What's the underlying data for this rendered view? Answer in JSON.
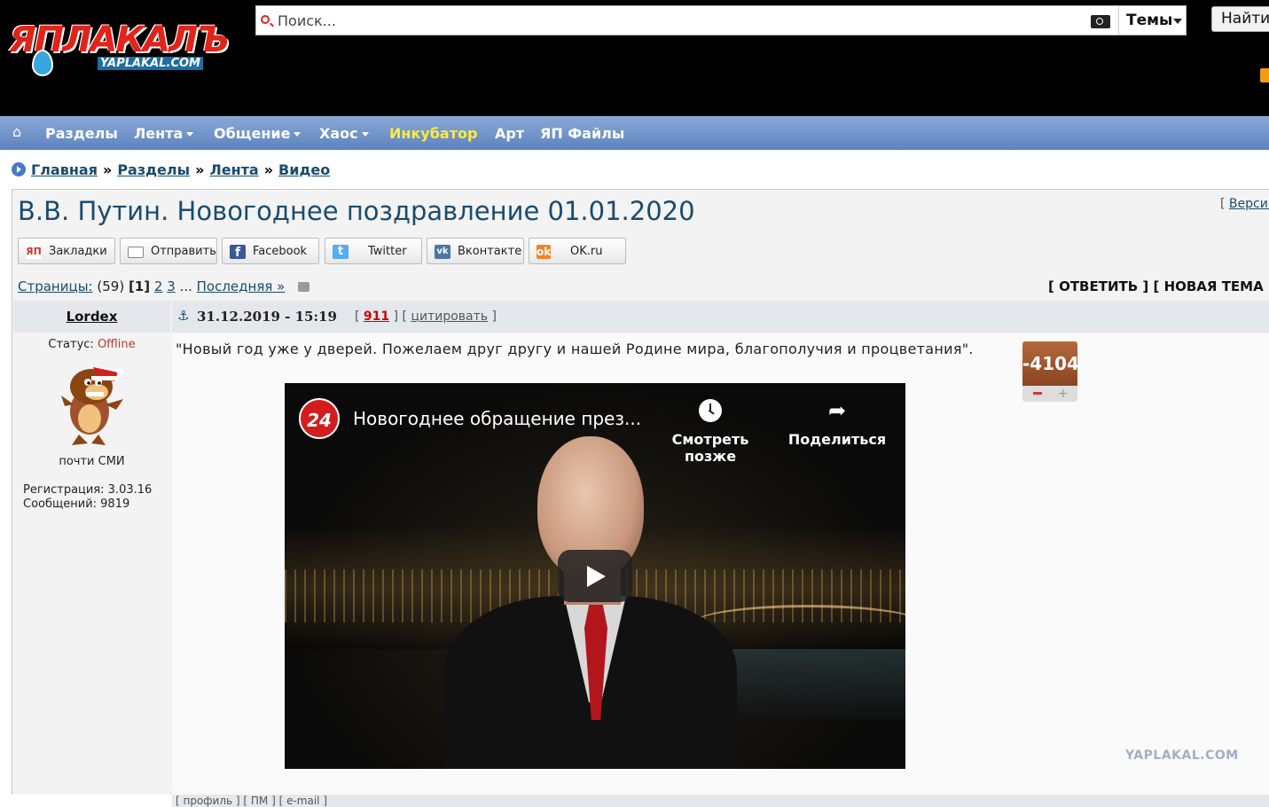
{
  "header": {
    "logo_text": "ЯПЛАКАЛЪ",
    "logo_sub": "YAPLAKAL.COM",
    "search_placeholder": "Поиск...",
    "topics_label": "Темы",
    "find_label": "Найти"
  },
  "nav": {
    "items": [
      {
        "label": "Разделы"
      },
      {
        "label": "Лента"
      },
      {
        "label": "Общение"
      },
      {
        "label": "Хаос"
      },
      {
        "label": "Инкубатор"
      },
      {
        "label": "Арт"
      },
      {
        "label": "ЯП Файлы"
      }
    ]
  },
  "breadcrumb": {
    "items": [
      "Главная",
      "Разделы",
      "Лента",
      "Видео"
    ],
    "sep": "»"
  },
  "topic": {
    "title": "В.В. Путин. Новогоднее поздравление 01.01.2020",
    "version_bracket": "[",
    "version_link": "Версия"
  },
  "share": [
    {
      "label": "Закладки",
      "icon": "yap-icon",
      "color": "#c0392b"
    },
    {
      "label": "Отправить",
      "icon": "mail-icon",
      "color": "#888888"
    },
    {
      "label": "Facebook",
      "icon": "facebook-icon",
      "color": "#3b5998"
    },
    {
      "label": "Twitter",
      "icon": "twitter-icon",
      "color": "#55acee"
    },
    {
      "label": "Вконтакте",
      "icon": "vk-icon",
      "color": "#4a76a8"
    },
    {
      "label": "OK.ru",
      "icon": "ok-icon",
      "color": "#f58220"
    }
  ],
  "pages": {
    "label": "Страницы:",
    "count": "(59)",
    "current": "[1]",
    "p2": "2",
    "p3": "3",
    "ellipsis": "...",
    "last": "Последняя »"
  },
  "actions": {
    "text": "[ ОТВЕТИТЬ ] [ НОВАЯ ТЕМА"
  },
  "post": {
    "author": "Lordex",
    "date": "31.12.2019 - 15:19",
    "bracket_open": "[",
    "number": "911",
    "bracket_mid": "] [",
    "quote_label": "цитировать",
    "bracket_close": "]",
    "status_label": "Статус:",
    "status_value": "Offline",
    "user_title": "почти СМИ",
    "reg_label": "Регистрация: 3.03.16",
    "messages_label": "Сообщений: 9819",
    "text": "\"Новый год уже у дверей. Пожелаем друг другу и нашей Родине мира, благополучия и процветания\".",
    "rating": "-4104",
    "footer": "[ профиль ] [ ПМ ] [ e-mail ]"
  },
  "video": {
    "channel": "24",
    "title": "Новогоднее обращение през...",
    "watch_later": "Смотреть позже",
    "share": "Поделиться"
  },
  "watermark": "YAPLAKAL.COM"
}
